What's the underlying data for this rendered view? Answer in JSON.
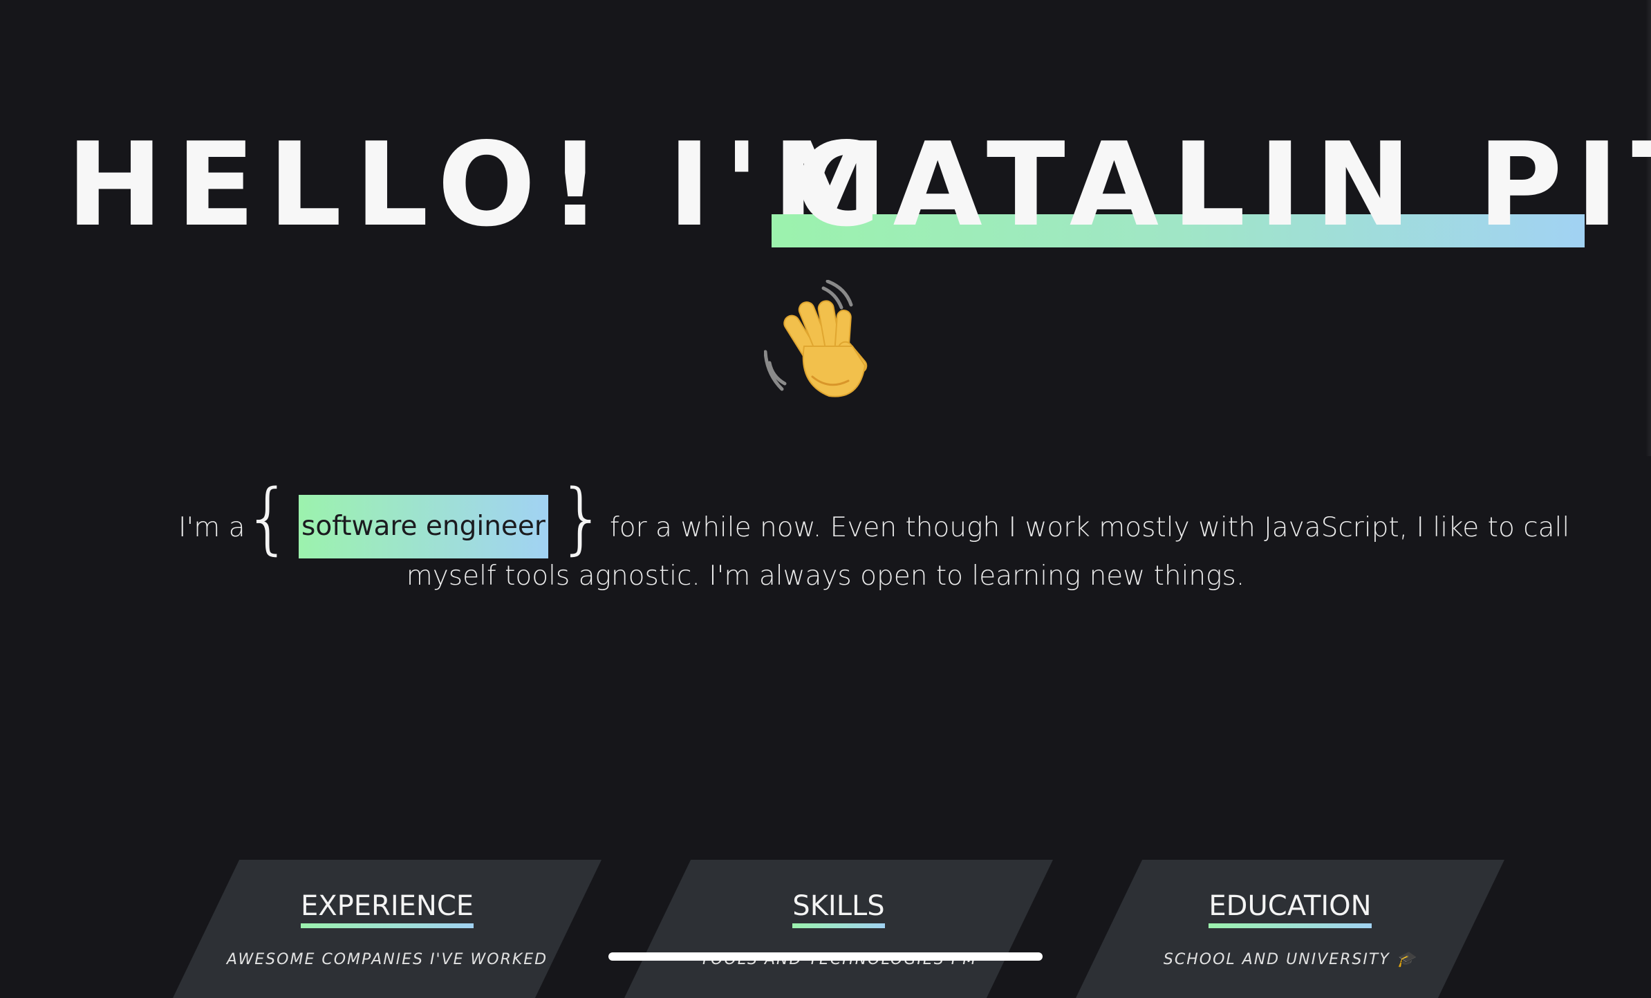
{
  "hero": {
    "intro": "HELLO! I'M",
    "name": "CATALIN PIT"
  },
  "wave_icon": "waving-hand-icon",
  "intro": {
    "prefix": "I'm a",
    "brace_open": "{",
    "role": "software engineer",
    "brace_close": "}",
    "rest": "for a while now. Even though I work mostly with JavaScript, I like to call",
    "line2": "myself tools agnostic. I'm always open to learning new things."
  },
  "sections": [
    {
      "title": "EXPERIENCE",
      "subtitle": "AWESOME COMPANIES I'VE WORKED"
    },
    {
      "title": "SKILLS",
      "subtitle": "TOOLS AND TECHNOLOGIES I'M"
    },
    {
      "title": "EDUCATION",
      "subtitle": "SCHOOL AND UNIVERSITY 🎓"
    }
  ],
  "colors": {
    "background": "#16161a",
    "card": "#2d3035",
    "accent_start": "#9cf2ad",
    "accent_end": "#a1d2f3",
    "text": "#f4f4f4"
  }
}
